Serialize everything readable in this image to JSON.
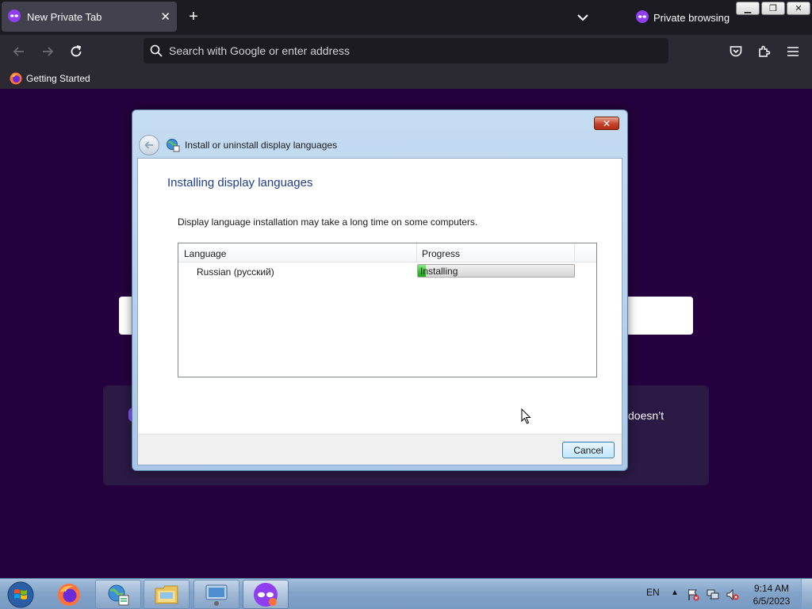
{
  "browser": {
    "tab_title": "New Private Tab",
    "private_label": "Private browsing",
    "search_placeholder": "Search with Google or enter address",
    "bookmark_label": "Getting Started",
    "accent_color": "#25003e"
  },
  "page": {
    "card_text_fragment": "doesn’t"
  },
  "dialog": {
    "title": "Install or uninstall display languages",
    "heading": "Installing display languages",
    "description": "Display language installation may take a long time on some computers.",
    "columns": {
      "language": "Language",
      "progress": "Progress"
    },
    "rows": [
      {
        "language": "Russian (русский)",
        "status": "Installing",
        "progress_fraction": 0.05
      }
    ],
    "cancel_label": "Cancel"
  },
  "taskbar": {
    "language": "EN",
    "time": "9:14 AM",
    "date": "6/5/2023"
  },
  "icons": {
    "tab": "private-mask-icon",
    "close": "close-icon",
    "new_tab": "plus-icon",
    "list_tabs": "chevron-down-icon",
    "back": "back-arrow-icon",
    "forward": "forward-arrow-icon",
    "reload": "reload-icon",
    "search": "search-icon",
    "pocket": "pocket-icon",
    "extensions": "extensions-icon",
    "menu": "hamburger-menu-icon"
  }
}
